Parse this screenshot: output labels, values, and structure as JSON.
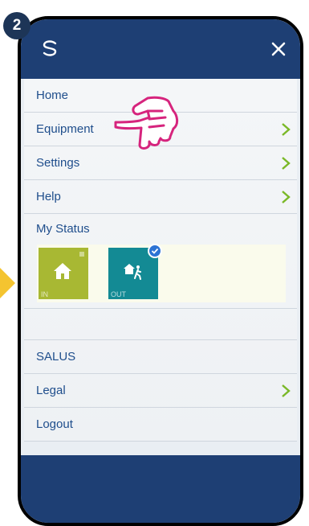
{
  "step": "2",
  "menu": {
    "items": [
      {
        "label": "Home",
        "chevron": false
      },
      {
        "label": "Equipment",
        "chevron": true
      },
      {
        "label": "Settings",
        "chevron": true
      },
      {
        "label": "Help",
        "chevron": true
      }
    ],
    "status_label": "My Status",
    "status_tiles": [
      {
        "label": "IN",
        "icon": "home-icon",
        "color": "#a8b833",
        "selected": false
      },
      {
        "label": "OUT",
        "icon": "leaving-person-icon",
        "color": "#138a94",
        "selected": true
      }
    ],
    "lower_items": [
      {
        "label": "SALUS",
        "chevron": false
      },
      {
        "label": "Legal",
        "chevron": true
      },
      {
        "label": "Logout",
        "chevron": false
      }
    ]
  },
  "colors": {
    "header": "#1e3f74",
    "accent_green": "#7ab827",
    "badge": "#1d3557",
    "pointer": "#d6247d",
    "arrow": "#f4c430"
  }
}
